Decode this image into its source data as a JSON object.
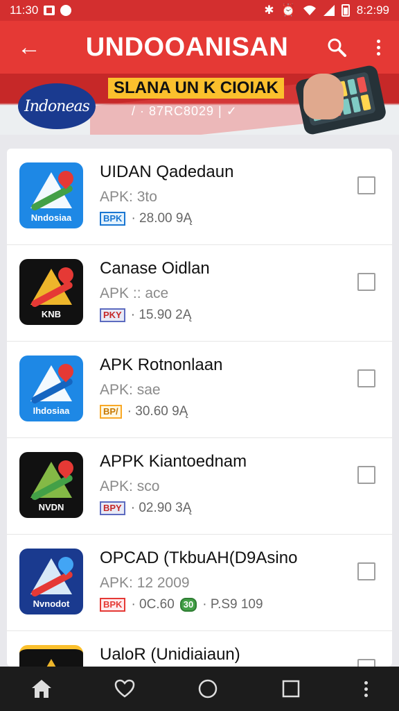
{
  "status_bar": {
    "time_left": "11:30",
    "time_right": "8:2:99"
  },
  "app_bar": {
    "title": "UNDOOANISAN",
    "back_icon": "back-arrow-icon",
    "search_icon": "search-icon",
    "more_icon": "more-vert-icon"
  },
  "banner": {
    "logo_text": "Indoneas",
    "headline": "SLANA UN K CIOIAK",
    "subline": "/ · 87RC8029 | ✓"
  },
  "colors": {
    "primary": "#e53935",
    "status": "#d32f2f",
    "nav": "#1c1c1c"
  },
  "items": [
    {
      "name": "UIDAN Qadedaun",
      "subtitle": "APK: 3to",
      "badge": "BPK",
      "badge_color": "blue",
      "stats": "· 28.00  9Ą",
      "icon_label": "Nndosiaa",
      "icon_theme": "blue",
      "checked": false
    },
    {
      "name": "Canase Oidlan",
      "subtitle": "APK :: ace",
      "badge": "PKY",
      "badge_color": "purple",
      "stats": "· 15.90  2Ą",
      "icon_label": "KNB",
      "icon_theme": "black",
      "checked": false
    },
    {
      "name": "APK Rotnonlaan",
      "subtitle": "APK: sae",
      "badge": "BP/",
      "badge_color": "orange",
      "stats": "· 30.60  9Ą",
      "icon_label": "Ihdosiaa",
      "icon_theme": "blue",
      "checked": false
    },
    {
      "name": "APPK Kiantoednam",
      "subtitle": "APK: sco",
      "badge": "BPY",
      "badge_color": "purple",
      "stats": "· 02.90  3Ą",
      "icon_label": "NVDN",
      "icon_theme": "black",
      "checked": false
    },
    {
      "name": "OPCAD (TkbuAH(D9Asino",
      "subtitle": "APK: 12 2009",
      "badge": "BPK",
      "badge_color": "red",
      "stats": "· 0C.60",
      "badge2": "30",
      "stats2": "·  P.S9 109",
      "icon_label": "Nvnodot",
      "icon_theme": "navy",
      "checked": false
    },
    {
      "name": "UaloR (Unidiaiaun)",
      "subtitle": "",
      "badge": "",
      "stats": "",
      "icon_label": "",
      "icon_theme": "black-gold",
      "checked": false
    }
  ],
  "nav": {
    "home_icon": "home-icon",
    "favorites_icon": "heart-icon",
    "circle_icon": "circle-home-icon",
    "recents_icon": "square-recents-icon",
    "menu_icon": "more-vert-icon"
  }
}
